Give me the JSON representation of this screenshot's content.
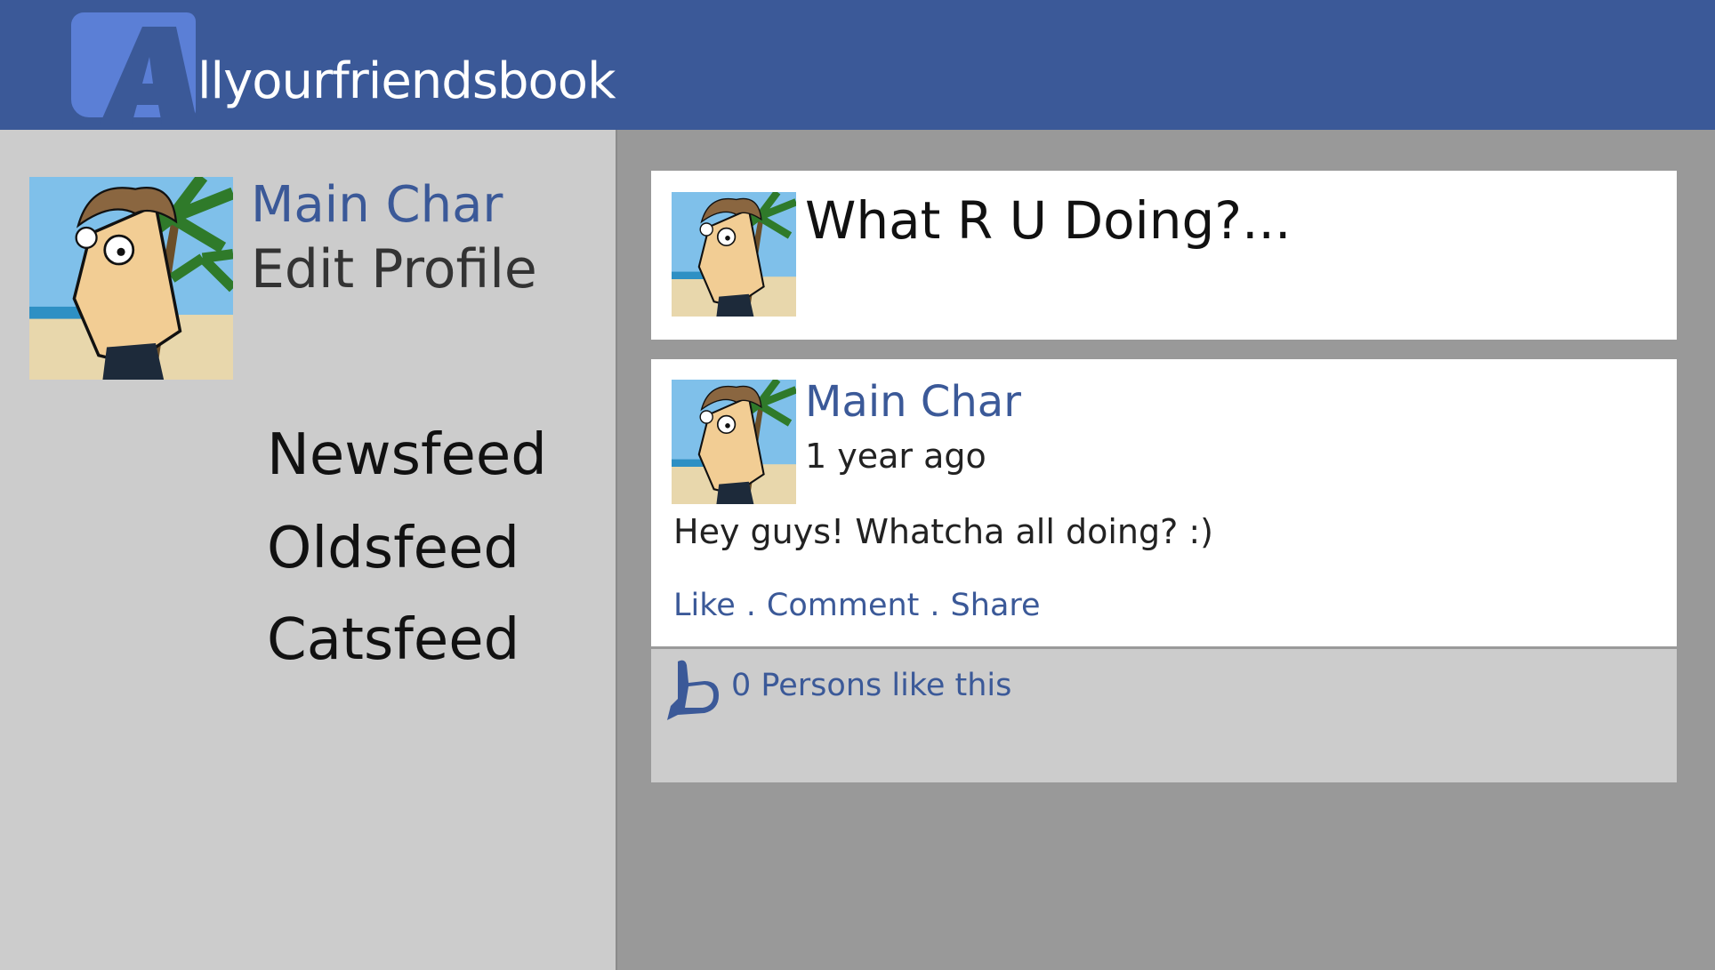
{
  "app": {
    "logo_text": "llyourfriendsbook",
    "logo_letter": "A",
    "brand_color": "#3b5998",
    "logo_box_color": "#5b7fd6"
  },
  "sidebar": {
    "profile_name": "Main Char",
    "edit_profile": "Edit Profile",
    "nav": [
      {
        "label": "Newsfeed"
      },
      {
        "label": "Oldsfeed"
      },
      {
        "label": "Catsfeed"
      }
    ]
  },
  "status": {
    "prompt": "What R U Doing?..."
  },
  "post": {
    "author": "Main Char",
    "time": "1 year ago",
    "body": "Hey guys! Whatcha all doing? :)",
    "actions": {
      "like": "Like",
      "comment": "Comment",
      "share": "Share",
      "separator": "."
    },
    "likes_text": "0 Persons like this",
    "like_icon": "thumbs-up-icon"
  }
}
